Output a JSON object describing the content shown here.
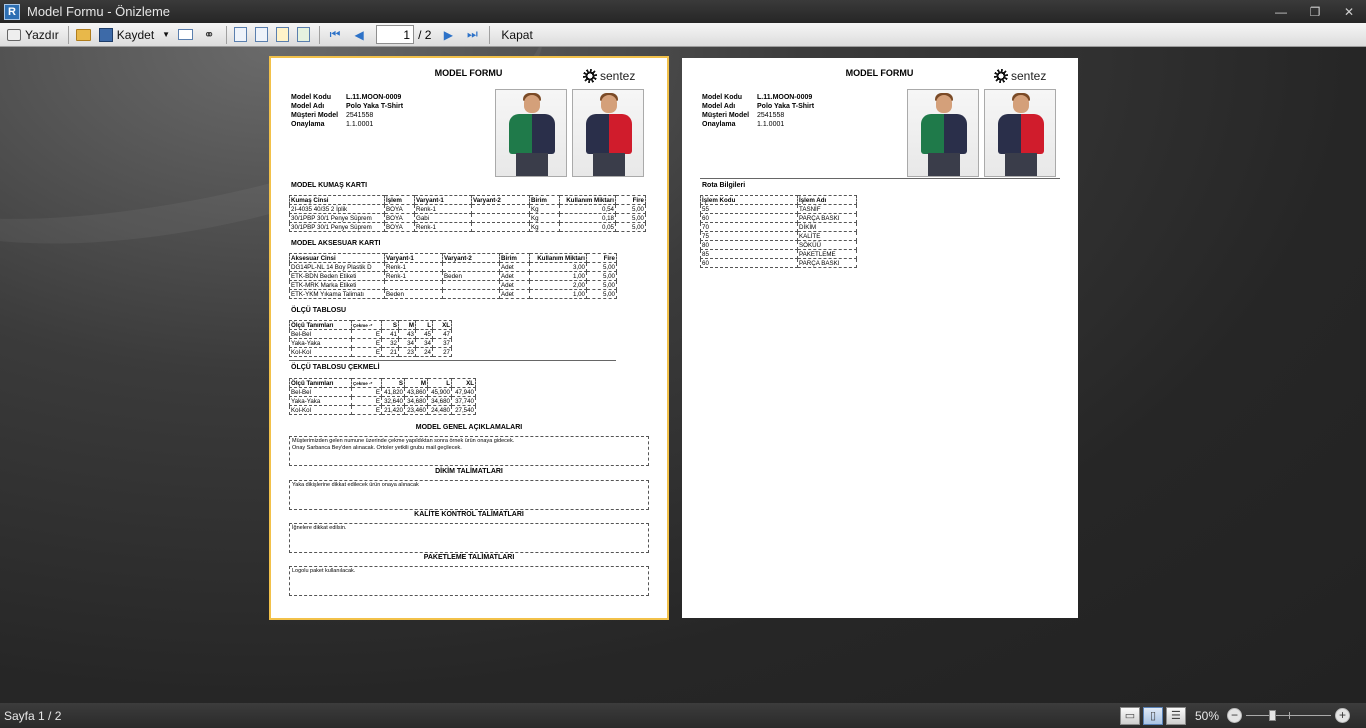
{
  "window": {
    "title": "Model Formu - Önizleme",
    "app_icon": "R",
    "minimize": "—",
    "maximize": "❐",
    "close": "✕"
  },
  "toolbar": {
    "print_label": "Yazdır",
    "save_label": "Kaydet",
    "close_label": "Kapat",
    "current_page": "1",
    "page_count": "/ 2"
  },
  "doc": {
    "title": "MODEL FORMU",
    "logo_text": "sentez",
    "info": [
      {
        "label": "Model Kodu",
        "value": "L.11.MOON-0009"
      },
      {
        "label": "Model Adı",
        "value": "Polo Yaka T-Shirt"
      },
      {
        "label": "Müşteri Model",
        "value": "2541558"
      },
      {
        "label": "Onaylama",
        "value": "1.1.0001"
      }
    ],
    "photo_colors": {
      "green": "#1f7a4a",
      "navy": "#2a2f4a",
      "red": "#d01c2c"
    }
  },
  "kumas": {
    "title": "MODEL KUMAŞ KARTI",
    "headers": [
      "Kumaş Cinsi",
      "İşlem",
      "Varyant-1",
      "Varyant-2",
      "Birim",
      "Kullanım Miktarı",
      "Fire"
    ],
    "rows": [
      [
        "2I-4035 40/35 2 İplik",
        "BOYA",
        "Renk-1",
        "",
        "Kg",
        "0,54",
        "5,00"
      ],
      [
        "30/1PBP 30/1 Penye Süprem",
        "BOYA",
        "Gabi",
        "",
        "Kg",
        "0,18",
        "5,00"
      ],
      [
        "30/1PBP 30/1 Penye Süprem",
        "BOYA",
        "Renk-1",
        "",
        "Kg",
        "0,05",
        "5,00"
      ]
    ]
  },
  "aksesuar": {
    "title": "MODEL AKSESUAR KARTI",
    "headers": [
      "Aksesuar Cinsi",
      "Varyant-1",
      "Varyant-2",
      "Birim",
      "Kullanım Miktarı",
      "Fire"
    ],
    "rows": [
      [
        "DG14PL-NL 14 Boy Plastik D",
        "Renk-1",
        "",
        "Adet",
        "3,00",
        "5,00"
      ],
      [
        "ETK-BDN Beden Etiketi",
        "Renk-1",
        "Beden",
        "Adet",
        "1,00",
        "5,00"
      ],
      [
        "ETK-MRK Marka Etiketi",
        "",
        "",
        "Adet",
        "2,00",
        "5,00"
      ],
      [
        "ETK-YKM Yıkama Talimatı",
        "Beden",
        "",
        "Adet",
        "1,00",
        "5,00"
      ]
    ]
  },
  "olcu": {
    "title": "ÖLÇÜ TABLOSU",
    "headers": [
      "Ölçü Tanımları",
      "Çekme -*",
      "S",
      "M",
      "L",
      "XL"
    ],
    "rows": [
      [
        "Bel-Bel",
        "E",
        "41",
        "43",
        "45",
        "47"
      ],
      [
        "Yaka-Yaka",
        "E",
        "32",
        "34",
        "34",
        "37"
      ],
      [
        "Kol-Kol",
        "E",
        "21",
        "23",
        "24",
        "27"
      ]
    ]
  },
  "olcu_cekme": {
    "title": "ÖLÇÜ TABLOSU ÇEKMELİ",
    "headers": [
      "Ölçü Tanımları",
      "Çekme -*",
      "S",
      "M",
      "L",
      "XL"
    ],
    "rows": [
      [
        "Bel-Bel",
        "E",
        "41,820",
        "43,860",
        "45,900",
        "47,940"
      ],
      [
        "Yaka-Yaka",
        "E",
        "32,640",
        "34,680",
        "34,680",
        "37,740"
      ],
      [
        "Kol-Kol",
        "E",
        "21,420",
        "23,460",
        "24,480",
        "27,540"
      ]
    ]
  },
  "notes": {
    "genel_title": "MODEL GENEL AÇIKLAMALARI",
    "genel_text1": "Müşterimizden gelen numune üzerinde çekme yapıldıktan sonra örnek ürün onaya gidecek.",
    "genel_text2": "Onay Sarbanca Bey'den alınacak. Ortoler yetkili grubu mail geçilecek.",
    "dikim_title": "DİKİM TALİMATLARI",
    "dikim_text": "Yaka dikişlerine dikkat edilecek ürün onaya alınacak",
    "kalite_title": "KALİTE KONTROL TALİMATLARI",
    "kalite_text": "İğnelere dikkat edilsin.",
    "paketleme_title": "PAKETLEME TALİMATLARI",
    "paketleme_text": "Logolu paket kullanılacak."
  },
  "rota": {
    "title": "Rota Bilgileri",
    "headers": [
      "İşlem Kodu",
      "İşlem Adı"
    ],
    "rows": [
      [
        "55",
        "TASNİF"
      ],
      [
        "60",
        "PARÇA BASKI"
      ],
      [
        "70",
        "DİKİM"
      ],
      [
        "75",
        "KALİTE"
      ],
      [
        "80",
        "SÖKÜÜ"
      ],
      [
        "85",
        "PAKETLEME"
      ],
      [
        "60",
        "PARÇA BASKI"
      ]
    ]
  },
  "status": {
    "text": "Sayfa 1 / 2",
    "zoom": "50%"
  }
}
